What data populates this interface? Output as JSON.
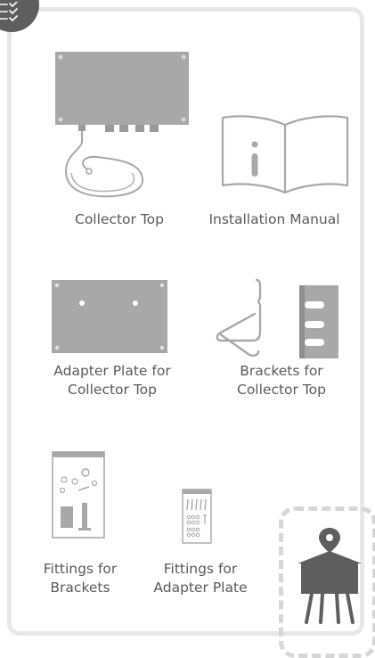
{
  "items": [
    {
      "label": "Collector Top"
    },
    {
      "label": "Installation Manual"
    },
    {
      "label_line1": "Adapter Plate for",
      "label_line2": "Collector Top"
    },
    {
      "label_line1": "Brackets for",
      "label_line2": "Collector Top"
    },
    {
      "label_line1": "Fittings for",
      "label_line2": "Brackets"
    },
    {
      "label_line1": "Fittings for",
      "label_line2": "Adapter Plate"
    }
  ],
  "colors": {
    "frame": "#e7e7e7",
    "badge": "#5e5e5e",
    "item_fill": "#a8a8a8",
    "outline": "#a0a0a0",
    "dashed": "#d6d6d6"
  },
  "icons": [
    "checklist-icon",
    "location-pin-icon"
  ]
}
